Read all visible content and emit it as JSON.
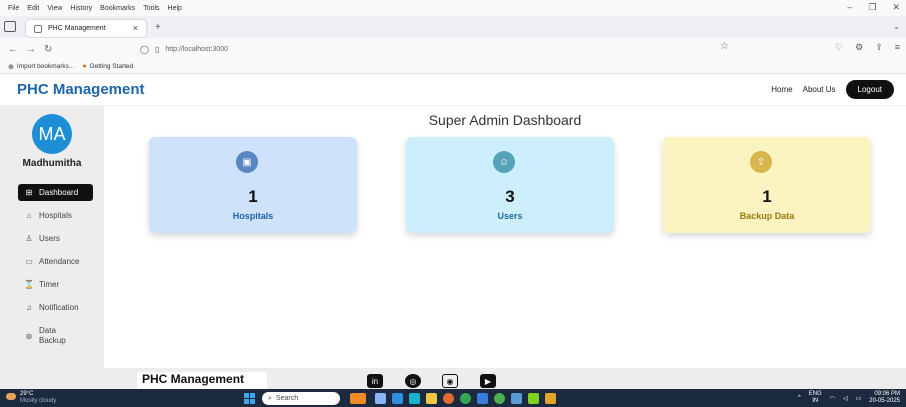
{
  "browser": {
    "menu": [
      "File",
      "Edit",
      "View",
      "History",
      "Bookmarks",
      "Tools",
      "Help"
    ],
    "tab_title": "PHC Management",
    "tab_close": "×",
    "new_tab": "+",
    "url": "http://localhost:3000",
    "bookmarks": [
      "Import bookmarks...",
      "Getting Started"
    ]
  },
  "app": {
    "brand": "PHC Management",
    "nav": {
      "home": "Home",
      "about": "About Us",
      "logout": "Logout"
    }
  },
  "sidebar": {
    "avatar_initials": "MA",
    "user_name": "Madhumitha",
    "items": [
      {
        "label": "Dashboard",
        "icon": "grid-icon",
        "active": true
      },
      {
        "label": "Hospitals",
        "icon": "hospital-icon"
      },
      {
        "label": "Users",
        "icon": "users-icon"
      },
      {
        "label": "Attendance",
        "icon": "calendar-icon"
      },
      {
        "label": "Timer",
        "icon": "hourglass-icon"
      },
      {
        "label": "Notification",
        "icon": "bell-icon"
      },
      {
        "label": "Data",
        "label2": "Backup",
        "icon": "backup-icon"
      }
    ]
  },
  "dashboard": {
    "title": "Super Admin Dashboard",
    "cards": [
      {
        "count": "1",
        "label": "Hospitals",
        "bg": "#cfe2fb",
        "icon_bg": "#5b86c4",
        "label_color": "#1f5fa8"
      },
      {
        "count": "3",
        "label": "Users",
        "bg": "#cdeffb",
        "icon_bg": "#56a2b8",
        "label_color": "#1d6fa0"
      },
      {
        "count": "1",
        "label": "Backup Data",
        "bg": "#fbf4c0",
        "icon_bg": "#d8b64e",
        "label_color": "#9a7b10"
      }
    ]
  },
  "footer": {
    "brand": "PHC Management",
    "social": [
      "in",
      "github",
      "instagram",
      "youtube"
    ]
  },
  "taskbar": {
    "weather_temp": "29°C",
    "weather_desc": "Mostly cloudy",
    "search": "Search",
    "lang": "ENG",
    "region": "IN",
    "time": "09:06 PM",
    "date": "20-05-2025"
  }
}
